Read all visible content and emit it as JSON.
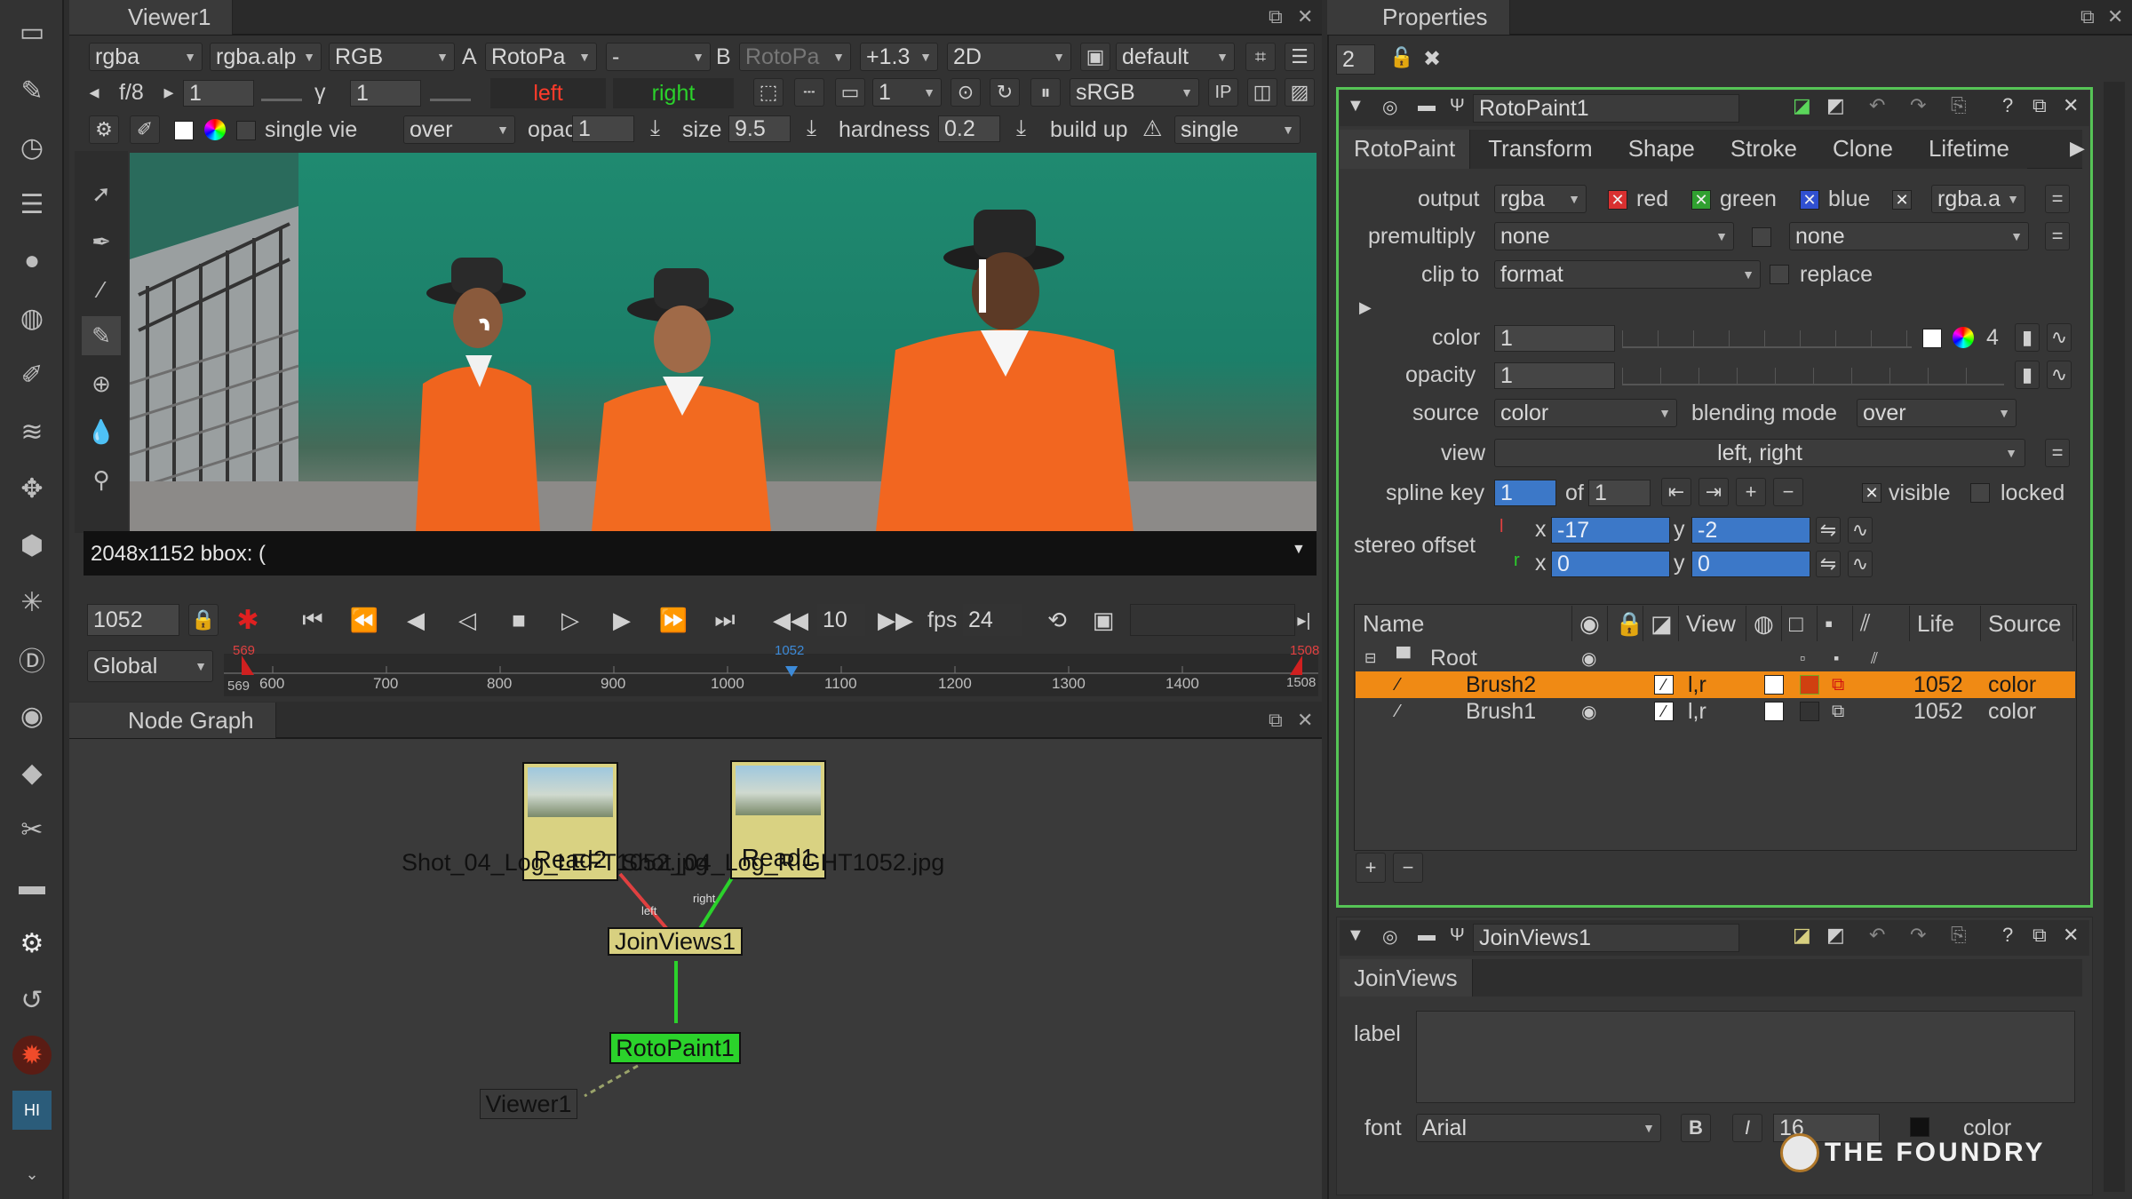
{
  "left_toolbar": {
    "icons": [
      "viewer-icon",
      "pen-icon",
      "clock-icon",
      "menu-icon",
      "sphere-icon",
      "globe-icon",
      "channel-icon",
      "layers-icon",
      "move-icon",
      "cube-icon",
      "particles-icon",
      "d-icon",
      "eye-icon",
      "tag-icon",
      "wrench-icon",
      "folder-icon",
      "gear-icon",
      "rotate-icon",
      "fire-icon",
      "hi-icon"
    ]
  },
  "viewer": {
    "tab_title": "Viewer1",
    "row1": {
      "channels": "rgba",
      "alpha": "rgba.alp",
      "rgb": "RGB",
      "a_label": "A",
      "a_input": "RotoPa",
      "b_sep": "-",
      "b_label": "B",
      "b_input": "RotoPa",
      "gain": "+1.3",
      "mode": "2D",
      "lut": "default"
    },
    "row2": {
      "fraction": "f/8",
      "frame": "1",
      "gamma_label": "γ",
      "gamma": "1",
      "left": "left",
      "right": "right",
      "proxy": "1",
      "colorspace": "sRGB",
      "ip": "IP"
    },
    "row3": {
      "single_view": "single vie",
      "blend": "over",
      "opacity_label": "opacity",
      "opacity": "1",
      "size_label": "size",
      "size": "9.5",
      "hardness_label": "hardness",
      "hardness": "0.2",
      "buildup_label": "build up",
      "single": "single"
    },
    "status": "2048x1152 bbox: (",
    "transport": {
      "frame": "1052",
      "step": "10",
      "fps_label": "fps",
      "fps": "24",
      "scope": "Global"
    },
    "timeline": {
      "start_marker": "569",
      "end_marker": "1508",
      "current": "1052",
      "ticks": [
        "600",
        "700",
        "800",
        "900",
        "1000",
        "1100",
        "1200",
        "1300",
        "1400"
      ],
      "start_label": "569",
      "end_label": "1508"
    }
  },
  "node_graph": {
    "tab_title": "Node Graph",
    "nodes": {
      "read2": "Read2",
      "read1": "Read1",
      "joinviews": "JoinViews1",
      "rotopaint": "RotoPaint1",
      "viewer": "Viewer1"
    },
    "labels": {
      "read2_file": "Shot_04_Log_LEFT1052.jpg",
      "read1_file": "Shot_04_Log_RIGHT1052.jpg",
      "left_pipe": "left",
      "right_pipe": "right"
    }
  },
  "properties": {
    "tab_title": "Properties",
    "max_panels": "2",
    "rotopaint": {
      "node_name": "RotoPaint1",
      "tabs": [
        "RotoPaint",
        "Transform",
        "Shape",
        "Stroke",
        "Clone",
        "Lifetime"
      ],
      "output_label": "output",
      "output": "rgba",
      "red": "red",
      "green": "green",
      "blue": "blue",
      "alpha": "rgba.a",
      "premultiply_label": "premultiply",
      "premultiply": "none",
      "premultiply2": "none",
      "clip_label": "clip to",
      "clip": "format",
      "replace": "replace",
      "color_label": "color",
      "color": "1",
      "color_count": "4",
      "opacity_label": "opacity",
      "opacity": "1",
      "source_label": "source",
      "source": "color",
      "blending_label": "blending mode",
      "blending": "over",
      "view_label": "view",
      "view": "left, right",
      "splinekey_label": "spline key",
      "splinekey": "1",
      "of_label": "of",
      "splinekey_total": "1",
      "visible": "visible",
      "locked": "locked",
      "stereo_label": "stereo offset",
      "l_label": "l",
      "r_label": "r",
      "x_label": "x",
      "y_label": "y",
      "lx": "-17",
      "ly": "-2",
      "rx": "0",
      "ry": "0",
      "columns": [
        "Name",
        "View",
        "Life",
        "Source"
      ],
      "rows": [
        {
          "name": "Root"
        },
        {
          "name": "Brush2",
          "view": "l,r",
          "life": "1052",
          "source": "color",
          "selected": true
        },
        {
          "name": "Brush1",
          "view": "l,r",
          "life": "1052",
          "source": "color",
          "selected": false
        }
      ],
      "add": "+",
      "remove": "−"
    },
    "joinviews": {
      "node_name": "JoinViews1",
      "tab": "JoinViews",
      "label_label": "label",
      "font_label": "font",
      "font": "Arial",
      "bold": "B",
      "italic": "I",
      "font_size": "16",
      "color_label": "color"
    },
    "watermark": "THE FOUNDRY"
  },
  "colors": {
    "accent_orange": "#f08a14",
    "node_green": "#2bd22b",
    "node_yellow": "#d8d080",
    "selection_blue": "#3c78c8",
    "panel_border_green": "#56c456"
  }
}
